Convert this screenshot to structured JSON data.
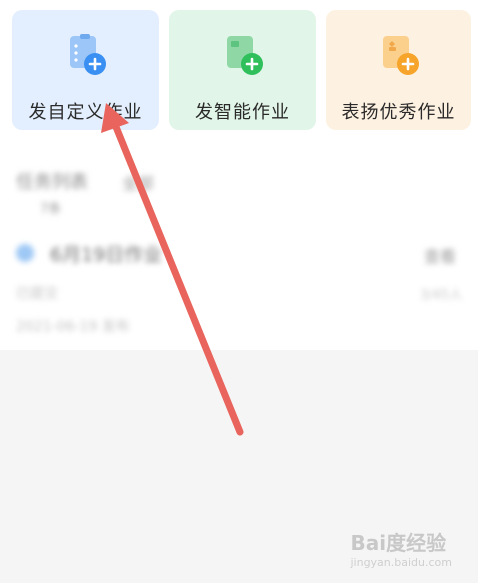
{
  "actions": [
    {
      "label": "发自定义作业",
      "icon": "custom-homework-icon",
      "accent": "#3a8ff2"
    },
    {
      "label": "发智能作业",
      "icon": "smart-homework-icon",
      "accent": "#2fbf5b"
    },
    {
      "label": "表扬优秀作业",
      "icon": "praise-homework-icon",
      "accent": "#f6a42a"
    }
  ],
  "blurred": {
    "section_title": "任务列表",
    "section_tab": "全部",
    "section_sub": "7条",
    "item_title": "6月19日作业",
    "item_meta": "已提交",
    "item_date": "2021-06-19 发布",
    "item_right": "查看",
    "item_right_meta": "3/45人"
  },
  "watermark": {
    "text": "Bai度经验",
    "sub": "jingyan.baidu.com"
  },
  "colors": {
    "arrow": "#e8645c"
  }
}
